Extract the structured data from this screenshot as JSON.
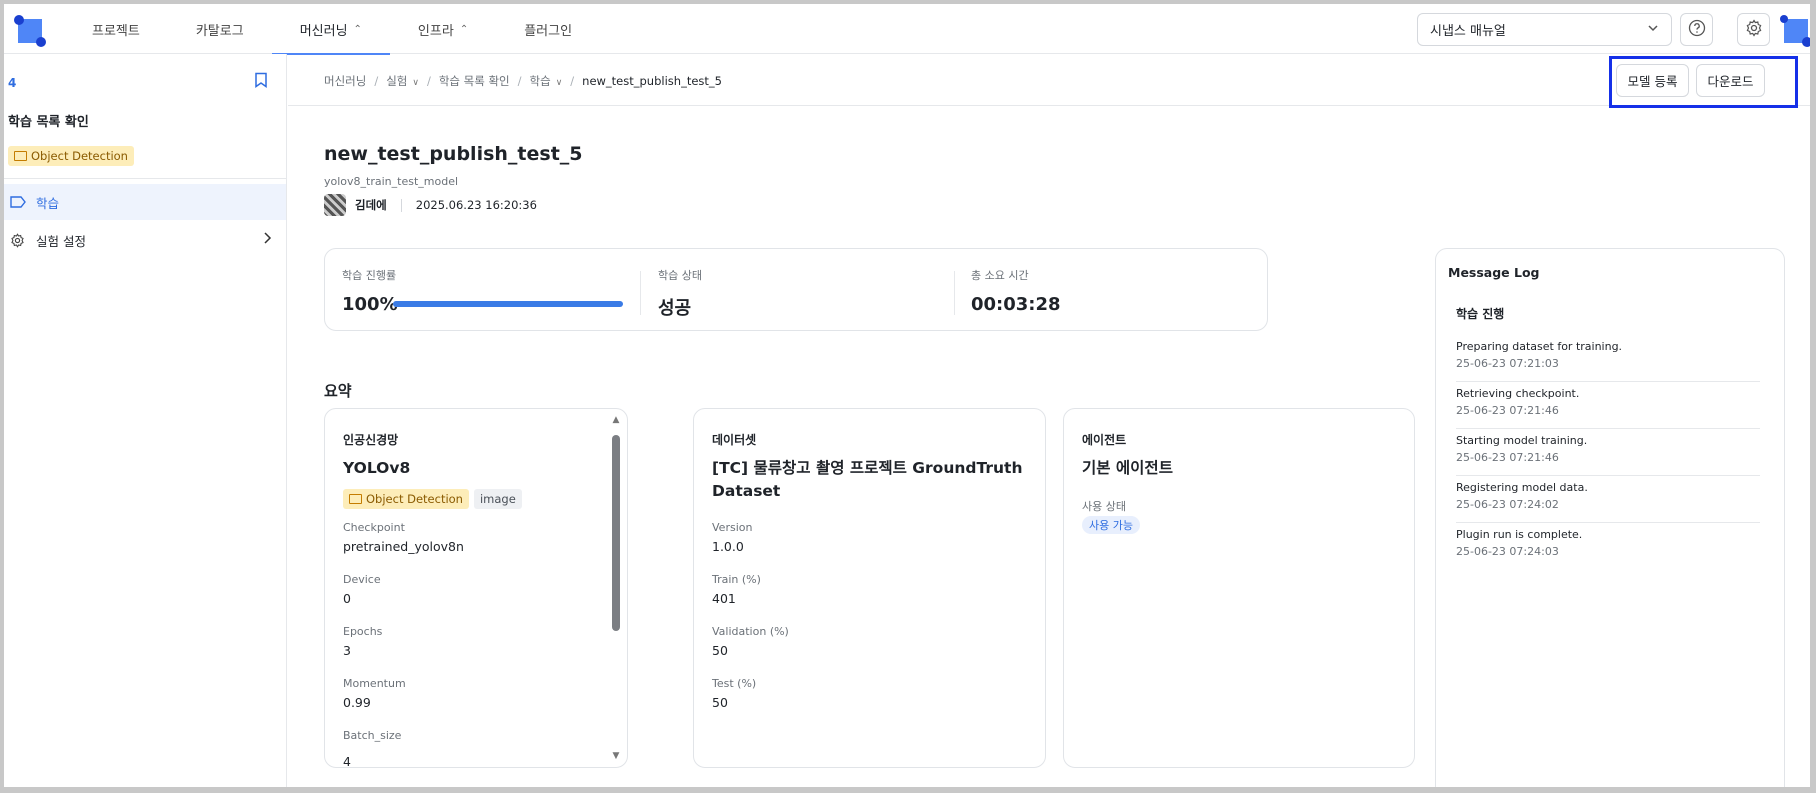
{
  "nav": {
    "tabs": [
      {
        "label": "프로젝트",
        "chevron": false
      },
      {
        "label": "카탈로그",
        "chevron": false
      },
      {
        "label": "머신러닝",
        "chevron": true
      },
      {
        "label": "인프라",
        "chevron": true
      },
      {
        "label": "플러그인",
        "chevron": false
      }
    ],
    "active_tab": "머신러닝",
    "manual_select": "시냅스 매뉴얼",
    "help_icon": "help-icon",
    "settings_icon": "gear-icon"
  },
  "sidebar": {
    "number": "4",
    "title": "학습 목록 확인",
    "badge": "Object Detection",
    "items": [
      {
        "label": "학습",
        "icon": "tag-icon",
        "active": true
      },
      {
        "label": "실험 설정",
        "icon": "gear-icon",
        "active": false
      }
    ]
  },
  "breadcrumb": {
    "items": [
      {
        "label": "머신러닝",
        "chevron": false
      },
      {
        "label": "실험",
        "chevron": true
      },
      {
        "label": "학습 목록 확인",
        "chevron": false
      },
      {
        "label": "학습",
        "chevron": true
      },
      {
        "label": "new_test_publish_test_5",
        "chevron": false
      }
    ]
  },
  "actions": {
    "register_label": "모델 등록",
    "download_label": "다운로드"
  },
  "page": {
    "title": "new_test_publish_test_5",
    "subtitle": "yolov8_train_test_model",
    "author": "김데에",
    "date": "2025.06.23 16:20:36"
  },
  "stats": {
    "progress_label": "학습 진행률",
    "progress_value": "100%",
    "progress_fraction": 1.0,
    "status_label": "학습 상태",
    "status_value": "성공",
    "time_label": "총 소요 시간",
    "time_value": "00:03:28"
  },
  "summary": {
    "title": "요약",
    "network": {
      "title": "인공신경망",
      "name": "YOLOv8",
      "badge_task": "Object Detection",
      "badge_type": "image",
      "fields": [
        {
          "label": "Checkpoint",
          "value": "pretrained_yolov8n"
        },
        {
          "label": "Device",
          "value": "0"
        },
        {
          "label": "Epochs",
          "value": "3"
        },
        {
          "label": "Momentum",
          "value": "0.99"
        },
        {
          "label": "Batch_size",
          "value": "4"
        }
      ]
    },
    "dataset": {
      "title": "데이터셋",
      "name_line1": "[TC] 물류창고 촬영 프로젝트 GroundTruth",
      "name_line2": "Dataset",
      "fields": [
        {
          "label": "Version",
          "value": "1.0.0"
        },
        {
          "label": "Train (%)",
          "value": "401"
        },
        {
          "label": "Validation (%)",
          "value": "50"
        },
        {
          "label": "Test (%)",
          "value": "50"
        }
      ]
    },
    "agent": {
      "title": "에이전트",
      "name": "기본 에이전트",
      "status_label": "사용 상태",
      "status_value": "사용 가능"
    }
  },
  "log": {
    "title": "Message Log",
    "section": "학습 진행",
    "entries": [
      {
        "message": "Preparing dataset for training.",
        "time": "25-06-23 07:21:03"
      },
      {
        "message": "Retrieving checkpoint.",
        "time": "25-06-23 07:21:46"
      },
      {
        "message": "Starting model training.",
        "time": "25-06-23 07:21:46"
      },
      {
        "message": "Registering model data.",
        "time": "25-06-23 07:24:02"
      },
      {
        "message": "Plugin run is complete.",
        "time": "25-06-23 07:24:03"
      }
    ]
  }
}
